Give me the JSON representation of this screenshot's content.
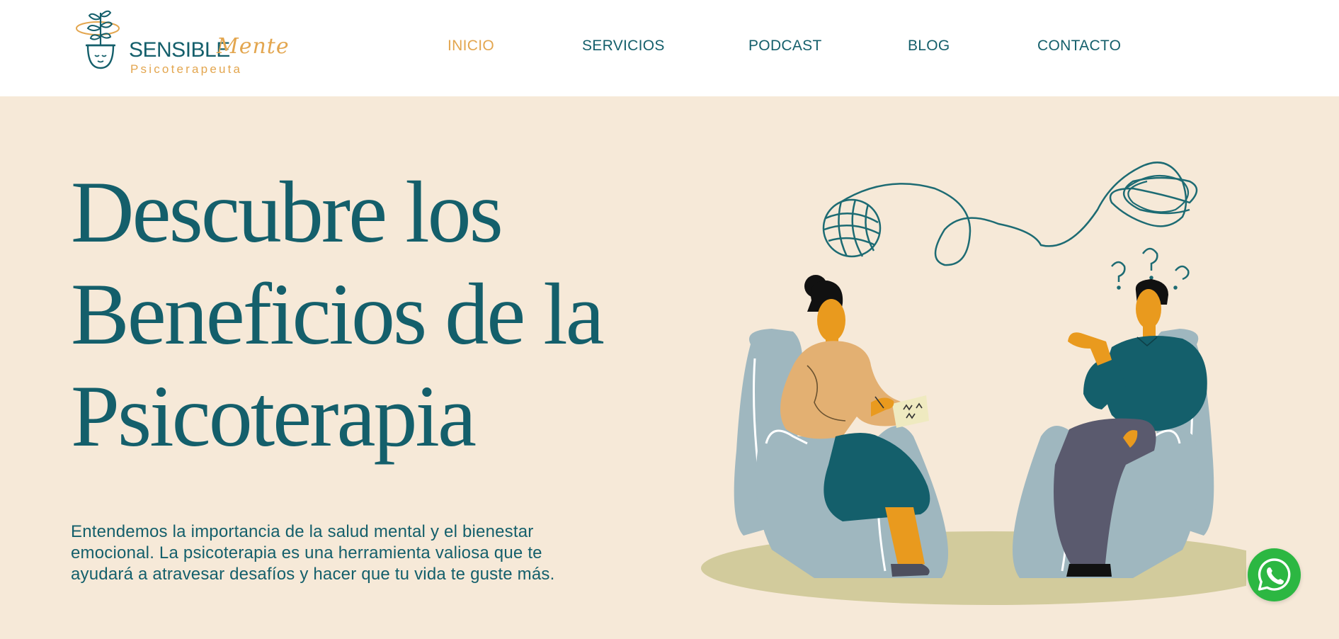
{
  "brand": {
    "name_part1": "SENSIBLE",
    "name_part2": "Mente",
    "subtitle": "Psicoterapeuta"
  },
  "nav": {
    "items": [
      {
        "label": "INICIO",
        "active": true
      },
      {
        "label": "SERVICIOS",
        "active": false
      },
      {
        "label": "PODCAST",
        "active": false
      },
      {
        "label": "BLOG",
        "active": false
      },
      {
        "label": "CONTACTO",
        "active": false
      }
    ]
  },
  "hero": {
    "title_lines": [
      "Descubre los",
      "Beneficios de la",
      "Psicoterapia"
    ],
    "description_lines": [
      "Entendemos la importancia de la salud mental y el bienestar",
      "emocional. La psicoterapia es una herramienta valiosa que te",
      "ayudará a atravesar desafíos y hacer que tu vida te guste más."
    ],
    "illustration": "therapy-session-illustration"
  },
  "whatsapp": {
    "icon": "whatsapp-icon"
  },
  "colors": {
    "primary": "#145f6b",
    "accent": "#e3a64f",
    "hero_bg": "#f6e9d8",
    "whatsapp": "#2cb742"
  }
}
